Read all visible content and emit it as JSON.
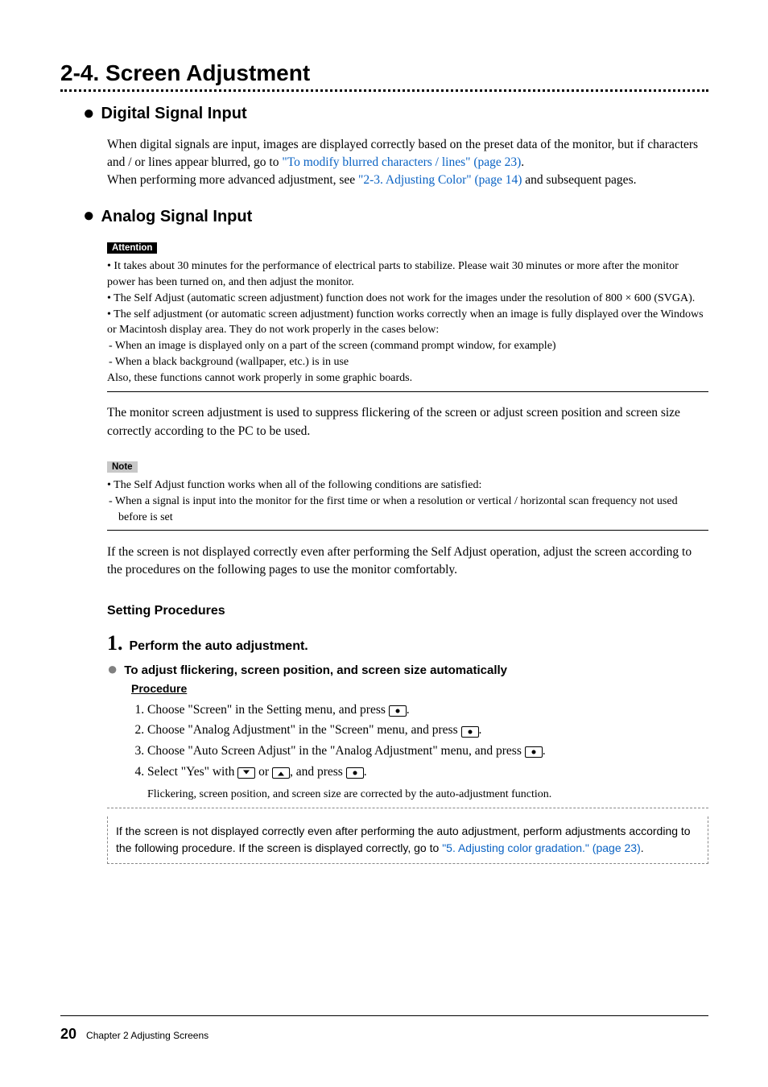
{
  "section": {
    "number": "2-4.",
    "title": "Screen Adjustment"
  },
  "digital": {
    "heading": "Digital Signal Input",
    "p1a": "When digital signals are input, images are displayed correctly based on the preset data of the monitor, but if characters and / or lines appear blurred, go to ",
    "link1": "\"To modify blurred characters / lines\" (page 23)",
    "p1b": ".",
    "p2a": "When performing more advanced adjustment, see ",
    "link2": "\"2-3. Adjusting Color\" (page 14)",
    "p2b": " and subsequent pages."
  },
  "analog": {
    "heading": "Analog Signal Input",
    "attention_label": "Attention",
    "attn": [
      "It takes about 30 minutes for the performance of electrical parts to stabilize. Please wait 30 minutes or more after the monitor power has been turned on, and then adjust the monitor.",
      "The Self Adjust (automatic screen adjustment) function does not work for the images under the resolution of 800 × 600 (SVGA).",
      "The self adjustment (or automatic screen adjustment) function works correctly when an image is fully displayed over the Windows or Macintosh display area. They do not work properly in the cases below:"
    ],
    "attn_sub": [
      "When an image is displayed only on a part of the screen (command prompt window, for example)",
      "When a black background (wallpaper, etc.) is in use"
    ],
    "attn_tail": "Also, these functions cannot work properly in some graphic boards.",
    "para_after_attn": "The monitor screen adjustment is used to suppress flickering of the screen or adjust screen position and screen size correctly according to the PC to be used.",
    "note_label": "Note",
    "note": "The Self Adjust function works when all of the following conditions are satisfied:",
    "note_sub": "When a signal is input into the monitor for the first time or when a resolution or vertical / horizontal scan frequency not used before is set",
    "para_after_note": "If the screen is not displayed correctly even after performing the Self Adjust operation, adjust the screen according to the procedures on the following pages to use the monitor comfortably.",
    "setting_procedures": "Setting Procedures",
    "step1": {
      "num": "1.",
      "title": "Perform the auto adjustment.",
      "sub": "To adjust flickering, screen position, and screen size automatically",
      "proc_label": "Procedure",
      "steps_a": [
        "Choose \"Screen\" in the Setting menu, and press ",
        "Choose \"Analog Adjustment\" in the \"Screen\" menu, and press ",
        "Choose \"Auto Screen Adjust\" in the \"Analog Adjustment\" menu, and press "
      ],
      "step4_a": "Select \"Yes\" with ",
      "step4_b": " or ",
      "step4_c": ", and press ",
      "result": "Flickering, screen position, and screen size are corrected by the auto-adjustment function.",
      "box_a": "If the screen is not displayed correctly even after performing the auto adjustment, perform adjustments according to the following procedure. If the screen is displayed correctly, go to ",
      "box_link": "\"5. Adjusting color gradation.\" (page 23)",
      "box_b": "."
    }
  },
  "footer": {
    "page": "20",
    "chapter": "Chapter 2  Adjusting Screens"
  }
}
